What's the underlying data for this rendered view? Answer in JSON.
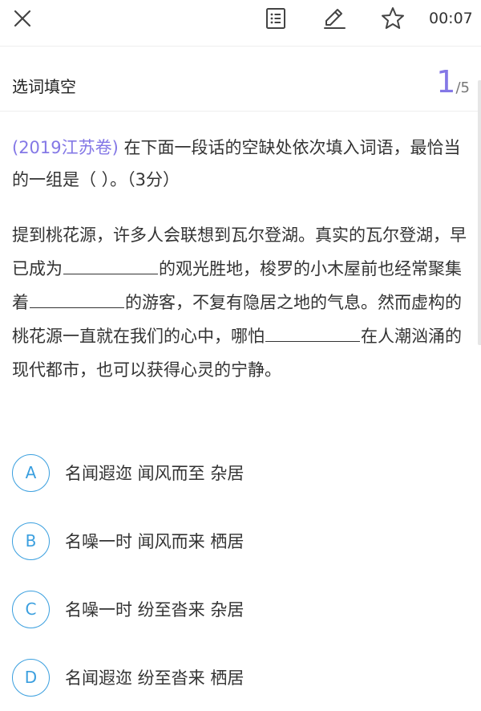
{
  "toolbar": {
    "timer": "00:07",
    "icons": [
      "close-icon",
      "answer-sheet-icon",
      "pen-icon",
      "star-icon"
    ]
  },
  "header": {
    "section_title": "选词填空",
    "current": "1",
    "total": "/5"
  },
  "question": {
    "source": "(2019江苏卷)",
    "stem": " 在下面一段话的空缺处依次填入词语，最恰当的一组是（ ）。（3分）",
    "passage_parts": [
      "提到桃花源，许多人会联想到瓦尔登湖。真实的瓦尔登湖，早已成为",
      "的观光胜地，梭罗的小木屋前也经常聚集着",
      "的游客，不复有隐居之地的气息。然而虚构的桃花源一直就在我们的心中，哪怕",
      "在人潮汹涌的现代都市，也可以获得心灵的宁静。"
    ]
  },
  "options": [
    {
      "letter": "A",
      "text": "名闻遐迩 闻风而至 杂居"
    },
    {
      "letter": "B",
      "text": "名噪一时 闻风而来 栖居"
    },
    {
      "letter": "C",
      "text": "名噪一时 纷至沓来 杂居"
    },
    {
      "letter": "D",
      "text": "名闻遐迩 纷至沓来 栖居"
    }
  ],
  "colors": {
    "accent_purple": "#8478e6",
    "option_blue": "#3a9fdf",
    "text": "#333333"
  }
}
